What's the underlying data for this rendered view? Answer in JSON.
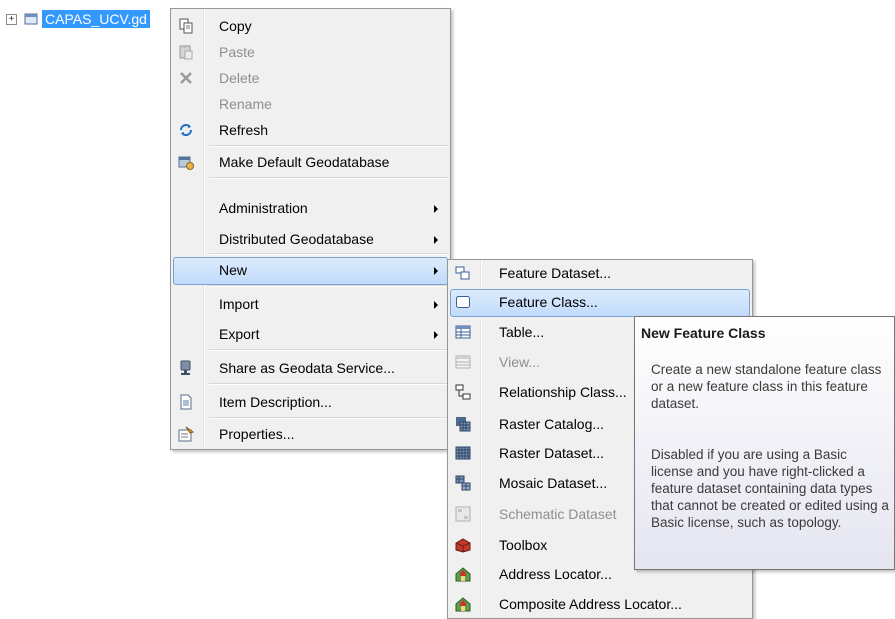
{
  "tree": {
    "node_label": "CAPAS_UCV.gd",
    "expander": "⊞"
  },
  "context_menu": {
    "items": [
      {
        "label": "Copy",
        "icon": "copy-icon",
        "enabled": true
      },
      {
        "label": "Paste",
        "icon": "paste-icon",
        "enabled": false
      },
      {
        "label": "Delete",
        "icon": "delete-icon",
        "enabled": false
      },
      {
        "label": "Rename",
        "icon": "",
        "enabled": false
      },
      {
        "label": "Refresh",
        "icon": "refresh-icon",
        "enabled": true
      },
      {
        "label": "Make Default Geodatabase",
        "icon": "make-default-geodatabase-icon",
        "enabled": true
      },
      {
        "label": "Administration",
        "icon": "",
        "enabled": true,
        "submenu": true
      },
      {
        "label": "Distributed Geodatabase",
        "icon": "",
        "enabled": true,
        "submenu": true
      },
      {
        "label": "New",
        "icon": "",
        "enabled": true,
        "submenu": true,
        "highlighted": true
      },
      {
        "label": "Import",
        "icon": "",
        "enabled": true,
        "submenu": true
      },
      {
        "label": "Export",
        "icon": "",
        "enabled": true,
        "submenu": true
      },
      {
        "label": "Share as Geodata Service...",
        "icon": "share-service-icon",
        "enabled": true
      },
      {
        "label": "Item Description...",
        "icon": "item-description-icon",
        "enabled": true
      },
      {
        "label": "Properties...",
        "icon": "properties-icon",
        "enabled": true
      }
    ]
  },
  "new_submenu": {
    "items": [
      {
        "label": "Feature Dataset...",
        "icon": "feature-dataset-icon",
        "enabled": true
      },
      {
        "label": "Feature Class...",
        "icon": "feature-class-icon",
        "enabled": true,
        "highlighted": true
      },
      {
        "label": "Table...",
        "icon": "table-icon",
        "enabled": true
      },
      {
        "label": "View...",
        "icon": "view-icon",
        "enabled": false
      },
      {
        "label": "Relationship Class...",
        "icon": "relationship-class-icon",
        "enabled": true
      },
      {
        "label": "Raster Catalog...",
        "icon": "raster-catalog-icon",
        "enabled": true
      },
      {
        "label": "Raster Dataset...",
        "icon": "raster-dataset-icon",
        "enabled": true
      },
      {
        "label": "Mosaic Dataset...",
        "icon": "mosaic-dataset-icon",
        "enabled": true
      },
      {
        "label": "Schematic Dataset",
        "icon": "schematic-dataset-icon",
        "enabled": false
      },
      {
        "label": "Toolbox",
        "icon": "toolbox-icon",
        "enabled": true
      },
      {
        "label": "Address Locator...",
        "icon": "address-locator-icon",
        "enabled": true
      },
      {
        "label": "Composite Address Locator...",
        "icon": "composite-address-locator-icon",
        "enabled": true
      }
    ]
  },
  "tooltip": {
    "title": "New Feature Class",
    "para1": "Create a new standalone feature class or a new feature class in this feature dataset.",
    "para2": "Disabled if you are using a Basic license and you have right-clicked a feature dataset containing data types that cannot be created or edited using a Basic license, such as topology."
  }
}
